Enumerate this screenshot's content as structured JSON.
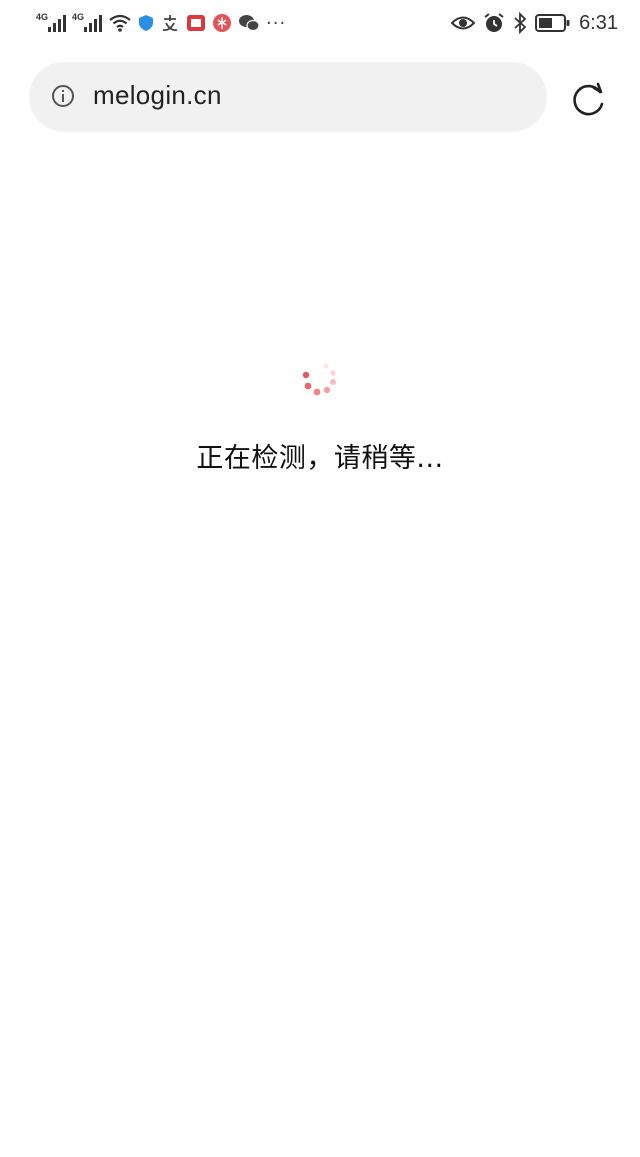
{
  "status_bar": {
    "network_1": "4G",
    "network_2": "4G",
    "time": "6:31",
    "more_indicator": "···",
    "icons": [
      "wifi-icon",
      "shield-icon",
      "alipay-icon",
      "book-icon",
      "app-icon",
      "wechat-icon",
      "eye-icon",
      "alarm-icon",
      "bluetooth-icon",
      "battery-icon"
    ]
  },
  "browser": {
    "url": "melogin.cn"
  },
  "page": {
    "loading_message": "正在检测，请稍等..."
  },
  "colors": {
    "accent": "#e0444a",
    "url_bar_bg": "#f1f1f1"
  }
}
